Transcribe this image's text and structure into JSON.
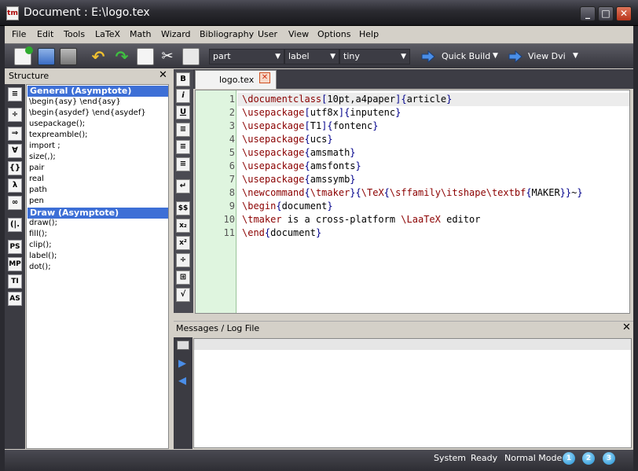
{
  "window": {
    "title": "Document : E:\\logo.tex",
    "app_icon_text": "tm"
  },
  "menu": [
    "File",
    "Edit",
    "Tools",
    "LaTeX",
    "Math",
    "Wizard",
    "Bibliography",
    "User",
    "View",
    "Options",
    "Help"
  ],
  "toolbar": {
    "combo_section": "part",
    "combo_label": "label",
    "combo_size": "tiny",
    "quick_build": "Quick Build",
    "view_dvi": "View Dvi"
  },
  "structure": {
    "title": "Structure",
    "icons": [
      "≡",
      "÷",
      "⇒",
      "∀",
      "{}",
      "λ",
      "∞",
      "(|.",
      "PS",
      "MP",
      "TI",
      "AS"
    ],
    "items": [
      {
        "text": "General (Asymptote)",
        "header": true
      },
      {
        "text": "\\begin{asy} \\end{asy}"
      },
      {
        "text": "\\begin{asydef} \\end{asydef}"
      },
      {
        "text": "usepackage();"
      },
      {
        "text": "texpreamble();"
      },
      {
        "text": "import ;"
      },
      {
        "text": "size(,);"
      },
      {
        "text": "pair"
      },
      {
        "text": "real"
      },
      {
        "text": "path"
      },
      {
        "text": "pen"
      },
      {
        "text": "Draw  (Asymptote)",
        "header": true
      },
      {
        "text": "draw();"
      },
      {
        "text": "fill();"
      },
      {
        "text": "clip();"
      },
      {
        "text": "label();"
      },
      {
        "text": "dot();"
      }
    ]
  },
  "format_icons": [
    "B",
    "i",
    "U",
    "≡",
    "≡",
    "≡",
    "↵",
    "$$",
    "x₂",
    "x²",
    "÷",
    "⊞",
    "√"
  ],
  "editor": {
    "tab": "logo.tex",
    "lines": [
      {
        "n": "1",
        "text": "\\documentclass[10pt,a4paper]{article}"
      },
      {
        "n": "2",
        "text": "\\usepackage[utf8x]{inputenc}"
      },
      {
        "n": "3",
        "text": "\\usepackage[T1]{fontenc}"
      },
      {
        "n": "4",
        "text": "\\usepackage{ucs}"
      },
      {
        "n": "5",
        "text": "\\usepackage{amsmath}"
      },
      {
        "n": "6",
        "text": "\\usepackage{amsfonts}"
      },
      {
        "n": "7",
        "text": "\\usepackage{amssymb}"
      },
      {
        "n": "8",
        "text": "\\newcommand{\\tmaker}{\\TeX{\\sffamily\\itshape\\textbf{MAKER}}~}"
      },
      {
        "n": "9",
        "text": "\\begin{document}"
      },
      {
        "n": "10",
        "text": "\\tmaker is a cross-platform \\LaaTeX editor"
      },
      {
        "n": "11",
        "text": "\\end{document}"
      }
    ]
  },
  "messages": {
    "title": "Messages / Log File"
  },
  "status": {
    "system": "System",
    "ready": "Ready",
    "mode": "Normal Mode",
    "badges": [
      "1",
      "2",
      "3"
    ]
  }
}
